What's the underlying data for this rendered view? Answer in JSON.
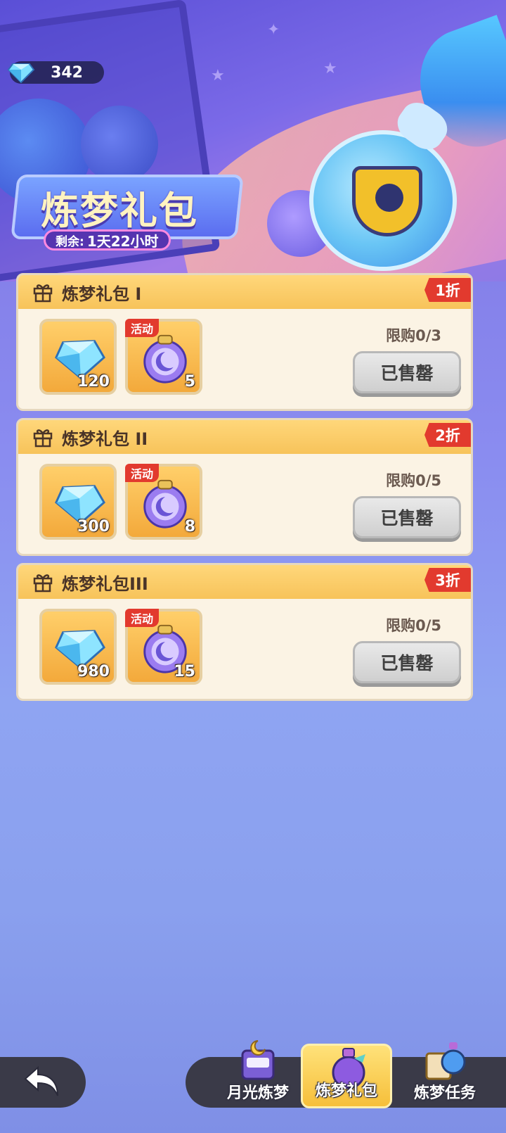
{
  "currency": {
    "icon": "diamond-icon",
    "amount": "342"
  },
  "banner": {
    "title": "炼梦礼包",
    "countdown_label": "剩余:",
    "countdown_value": "1天22小时"
  },
  "packs": [
    {
      "name": "炼梦礼包 I",
      "discount": "1折",
      "limit": "限购0/3",
      "button": "已售罄",
      "items": [
        {
          "icon": "diamond-icon",
          "qty": "120"
        },
        {
          "icon": "dream-potion-icon",
          "tag": "活动",
          "qty": "5"
        }
      ]
    },
    {
      "name": "炼梦礼包 II",
      "discount": "2折",
      "limit": "限购0/5",
      "button": "已售罄",
      "items": [
        {
          "icon": "diamond-icon",
          "qty": "300"
        },
        {
          "icon": "dream-potion-icon",
          "tag": "活动",
          "qty": "8"
        }
      ]
    },
    {
      "name": "炼梦礼包III",
      "discount": "3折",
      "limit": "限购0/5",
      "button": "已售罄",
      "items": [
        {
          "icon": "diamond-icon",
          "qty": "980"
        },
        {
          "icon": "dream-potion-icon",
          "tag": "活动",
          "qty": "15"
        }
      ]
    }
  ],
  "nav": {
    "back_icon": "back-arrow-icon",
    "tabs": [
      {
        "label": "月光炼梦",
        "icon": "moonlight-machine-icon",
        "active": false
      },
      {
        "label": "炼梦礼包",
        "icon": "potion-gift-icon",
        "active": true
      },
      {
        "label": "炼梦任务",
        "icon": "quest-scroll-icon",
        "active": false
      }
    ]
  },
  "colors": {
    "discount": "#e23a2e",
    "card_bg": "#fbf3e4",
    "header_gold": "#f7c35a",
    "sold_button": "#cfcfcf"
  }
}
